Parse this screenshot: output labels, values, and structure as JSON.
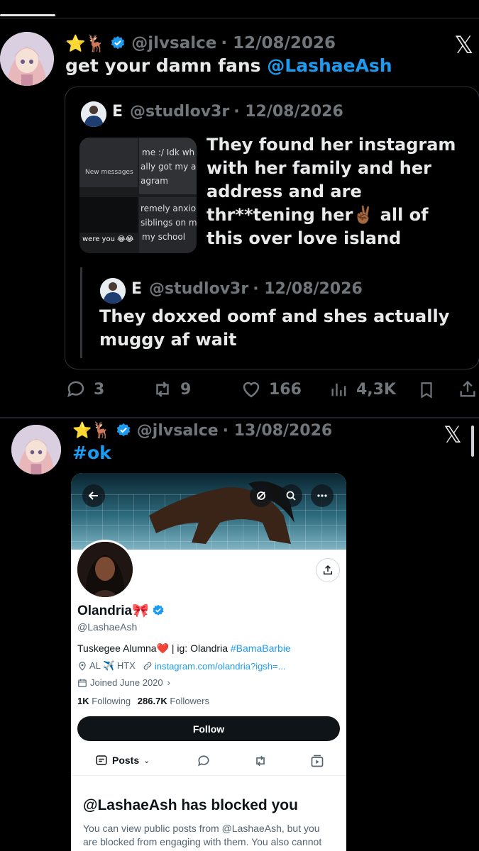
{
  "post1": {
    "emojis": "⭐🦌",
    "handle": "@jlvsalce",
    "date": "· 12/08/2026",
    "text_prefix": "get your damn fans ",
    "mention": "@LashaeAsh",
    "quote": {
      "name": "E",
      "handle": "@studlov3r",
      "date": "· 12/08/2026",
      "text": "They found her instagram with her family and her address and are thr**tening her✌🏾 all of this over love island",
      "thumb": {
        "line1": "me :/ Idk wh",
        "line2": "ally got my ac",
        "line3": "agram",
        "new_messages": "New messages",
        "line4": "remely anxio",
        "line5": "siblings on m",
        "line6": "my school",
        "were_you": "were you 😂😂"
      },
      "nested": {
        "name": "E",
        "handle": "@studlov3r",
        "date": "· 12/08/2026",
        "text": "They doxxed oomf and shes actually muggy af wait"
      }
    },
    "actions": {
      "replies": "3",
      "reposts": "9",
      "likes": "166",
      "views": "4,3K"
    }
  },
  "post2": {
    "emojis": "⭐🦌",
    "handle": "@jlvsalce",
    "date": "· 13/08/2026",
    "text": "#ok"
  },
  "profile": {
    "name": "Olandria🎀",
    "handle": "@LashaeAsh",
    "bio_text": "Tuskegee Alumna❤️ | ig: Olandria ",
    "bio_tag": "#BamaBarbie",
    "location": "AL ✈️ HTX",
    "link": "instagram.com/olandria?igsh=...",
    "joined": "Joined June 2020",
    "following_count": "1K",
    "following_label": "Following",
    "followers_count": "286.7K",
    "followers_label": "Followers",
    "follow_button": "Follow",
    "tab_posts": "Posts",
    "blocked_title": "@LashaeAsh has blocked you",
    "blocked_body": "You can view public posts from @LashaeAsh, but you are blocked from engaging with them. You also cannot follow or message @LashaeAsh."
  },
  "colors": {
    "accent": "#1d9bf0",
    "muted": "#71767b",
    "text": "#e7e9ea",
    "background": "#000000"
  }
}
